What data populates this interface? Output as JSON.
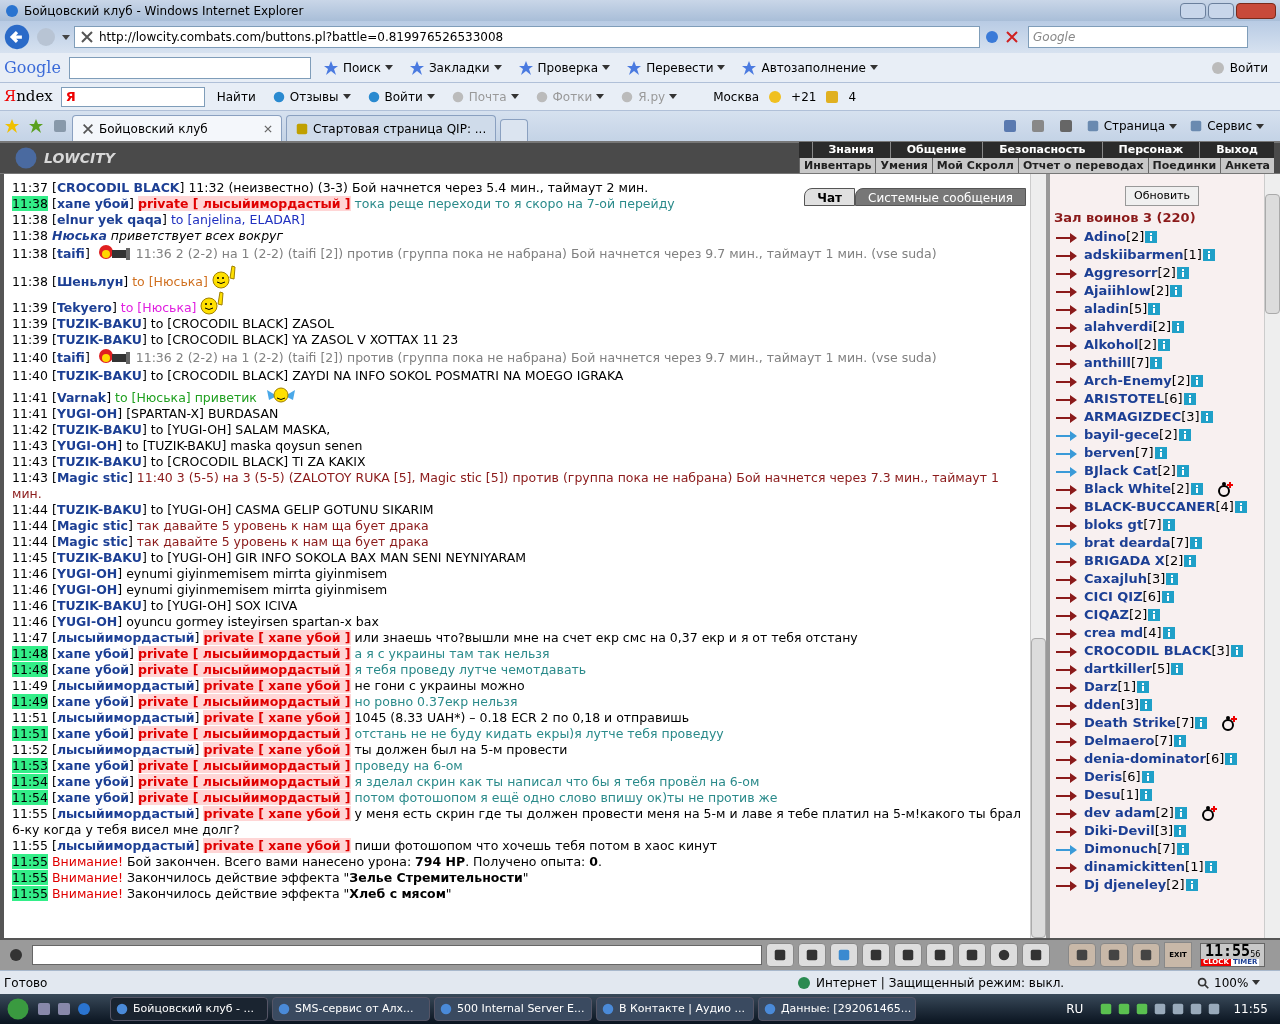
{
  "window": {
    "title": "Бойцовский клуб - Windows Internet Explorer"
  },
  "address_bar": {
    "url": "http://lowcity.combats.com/buttons.pl?battle=0.819976526533008",
    "search_placeholder": "Google"
  },
  "google_toolbar": {
    "logo": "Google",
    "items": [
      {
        "label": "Поиск"
      },
      {
        "label": "Закладки"
      },
      {
        "label": "Проверка"
      },
      {
        "label": "Перевести"
      },
      {
        "label": "Автозаполнение"
      }
    ],
    "sign_in": "Войти"
  },
  "yandex_toolbar": {
    "logo": "Яndex",
    "logo_short": "Я",
    "search_button": "Найти",
    "items": [
      {
        "label": "Отзывы",
        "disabled": false
      },
      {
        "label": "Войти",
        "disabled": false
      },
      {
        "label": "Почта",
        "disabled": true
      },
      {
        "label": "Фотки",
        "disabled": true
      },
      {
        "label": "Я.ру",
        "disabled": true
      }
    ],
    "city": "Москва",
    "temperature": "+21",
    "traffic": "4"
  },
  "browser_tabs": [
    {
      "label": "Бойцовский клуб",
      "selected": true
    },
    {
      "label": "Стартовая страница QIP: ...",
      "selected": false
    }
  ],
  "command_bar": [
    "Страница",
    "Сервис"
  ],
  "game_header": {
    "logo": "LOWCITY",
    "menu_top": [
      "Знания",
      "Общение",
      "Безопасность",
      "Персонаж",
      "Выход"
    ],
    "menu_bottom": [
      "Инвентарь",
      "Умения",
      "Мой Скролл",
      "Отчет о переводах",
      "Поединки",
      "Анкета"
    ]
  },
  "chat_tabs": [
    {
      "label": "Чат",
      "selected": true
    },
    {
      "label": "Системные сообщения",
      "selected": false
    }
  ],
  "messages": [
    {
      "time": "11:37",
      "highlighted": false,
      "kind": "chat",
      "sender": "[**CROCODIL BLACK**]",
      "parts": [
        {
          "kind": "text",
          "text": "11:32 (неизвестно) (3-3) Бой начнется через 5.4 мин., таймаут 2 мин.",
          "color": "#000000"
        }
      ]
    },
    {
      "time": "11:38",
      "highlighted": true,
      "kind": "chat",
      "sender": "[**хапе убой**]",
      "private": "private [ лысыйимордастый ]",
      "parts": [
        {
          "kind": "text",
          "text": "тока реще переходи то я скоро на 7-ой перейду",
          "color": "#2a8a8a"
        }
      ]
    },
    {
      "time": "11:38",
      "highlighted": false,
      "kind": "chat",
      "sender": "[**elnur yek qaqa**]",
      "parts": [
        {
          "kind": "text",
          "text": "to [anjelina, ELADAR]",
          "color": "#2030c0"
        }
      ]
    },
    {
      "time": "11:38",
      "highlighted": false,
      "kind": "action",
      "sender": "Нюська",
      "parts": [
        {
          "kind": "text",
          "text": "приветствует всех вокруг",
          "color": "#000000"
        }
      ]
    },
    {
      "time": "11:38",
      "highlighted": false,
      "kind": "chat",
      "sender": "[**taifi**]",
      "parts": [
        {
          "kind": "flag"
        },
        {
          "kind": "text",
          "text": "11:36 2 (2-2) на 1 (2-2) (taifi [2]) против (группа пока не набрана) Бой начнется через 9.7 мин., таймаут 1 мин. (vse suda)",
          "color": "#808080"
        }
      ]
    },
    {
      "time": "11:38",
      "highlighted": false,
      "kind": "chat",
      "sender": "[**Шеньлун**]",
      "parts": [
        {
          "kind": "text",
          "text": "to [Нюська]",
          "color": "#d07020"
        },
        {
          "kind": "wave"
        }
      ]
    },
    {
      "time": "11:39",
      "highlighted": false,
      "kind": "chat",
      "sender": "[**Tekyero**]",
      "parts": [
        {
          "kind": "text",
          "text": "to [Нюська]",
          "color": "#e020e0"
        },
        {
          "kind": "wave"
        }
      ]
    },
    {
      "time": "11:39",
      "highlighted": false,
      "kind": "chat",
      "sender": "[**TUZIK-BAKU**]",
      "parts": [
        {
          "kind": "text",
          "text": "to [CROCODIL BLACK] ZASOL",
          "color": "#000000"
        }
      ]
    },
    {
      "time": "11:39",
      "highlighted": false,
      "kind": "chat",
      "sender": "[**TUZIK-BAKU**]",
      "parts": [
        {
          "kind": "text",
          "text": "to [CROCODIL BLACK] YA ZASOL V XOTTAX 11 23",
          "color": "#000000"
        }
      ]
    },
    {
      "time": "11:40",
      "highlighted": false,
      "kind": "chat",
      "sender": "[**taifi**]",
      "parts": [
        {
          "kind": "flag"
        },
        {
          "kind": "text",
          "text": "11:36 2 (2-2) на 1 (2-2) (taifi [2]) против (группа пока не набрана) Бой начнется через 9.7 мин., таймаут 1 мин. (vse suda)",
          "color": "#808080"
        }
      ]
    },
    {
      "time": "11:40",
      "highlighted": false,
      "kind": "chat",
      "sender": "[**TUZIK-BAKU**]",
      "parts": [
        {
          "kind": "text",
          "text": "to [CROCODIL BLACK] ZAYDI NA INFO SOKOL POSMATRI NA MOEGO IGRAKA",
          "color": "#000000"
        }
      ]
    },
    {
      "time": "11:41",
      "highlighted": false,
      "kind": "chat",
      "sender": "[**Varnak**]",
      "parts": [
        {
          "kind": "text",
          "text": "to [Нюська] приветик",
          "color": "#20a020"
        },
        {
          "kind": "bird"
        }
      ]
    },
    {
      "time": "11:41",
      "highlighted": false,
      "kind": "chat",
      "sender": "[**YUGI-OH**]",
      "parts": [
        {
          "kind": "text",
          "text": "[SPARTAN-X] BURDASAN",
          "color": "#000000"
        }
      ]
    },
    {
      "time": "11:42",
      "highlighted": false,
      "kind": "chat",
      "sender": "[**TUZIK-BAKU**]",
      "parts": [
        {
          "kind": "text",
          "text": "to [YUGI-OH] SALAM MASKA,",
          "color": "#000000"
        }
      ]
    },
    {
      "time": "11:43",
      "highlighted": false,
      "kind": "chat",
      "sender": "[**YUGI-OH**]",
      "parts": [
        {
          "kind": "text",
          "text": "to [TUZIK-BAKU] maska qoysun senen",
          "color": "#000000"
        }
      ]
    },
    {
      "time": "11:43",
      "highlighted": false,
      "kind": "chat",
      "sender": "[**TUZIK-BAKU**]",
      "parts": [
        {
          "kind": "text",
          "text": "to [CROCODIL BLACK] TI ZA KAKIX",
          "color": "#000000"
        }
      ]
    },
    {
      "time": "11:43",
      "highlighted": false,
      "kind": "chat",
      "sender": "[**Magic stic**]",
      "parts": [
        {
          "kind": "text",
          "text": "11:40 3 (5-5) на 3 (5-5) (ZALOTOY RUKA [5], Magic stic [5]) против (группа пока не набрана) Бой начнется через 7.3 мин., таймаут 1 мин.",
          "color": "#8b1a1a"
        }
      ]
    },
    {
      "time": "11:44",
      "highlighted": false,
      "kind": "chat",
      "sender": "[**TUZIK-BAKU**]",
      "parts": [
        {
          "kind": "text",
          "text": "to [YUGI-OH] CASMA GELIP GOTUNU SIKARIM",
          "color": "#000000"
        }
      ]
    },
    {
      "time": "11:44",
      "highlighted": false,
      "kind": "chat",
      "sender": "[**Magic stic**]",
      "parts": [
        {
          "kind": "text",
          "text": "так давайте 5 уровень к нам ща бует драка",
          "color": "#8b1a1a"
        }
      ]
    },
    {
      "time": "11:44",
      "highlighted": false,
      "kind": "chat",
      "sender": "[**Magic stic**]",
      "parts": [
        {
          "kind": "text",
          "text": "так давайте 5 уровень к нам ща бует драка",
          "color": "#8b1a1a"
        }
      ]
    },
    {
      "time": "11:45",
      "highlighted": false,
      "kind": "chat",
      "sender": "[**TUZIK-BAKU**]",
      "parts": [
        {
          "kind": "text",
          "text": "to [YUGI-OH] GIR INFO SOKOLA BAX MAN SENI NEYNIYARAM",
          "color": "#000000"
        }
      ]
    },
    {
      "time": "11:46",
      "highlighted": false,
      "kind": "chat",
      "sender": "[**YUGI-OH**]",
      "parts": [
        {
          "kind": "text",
          "text": "eynumi giyinmemisem mirrta giyinmisem",
          "color": "#000000"
        }
      ]
    },
    {
      "time": "11:46",
      "highlighted": false,
      "kind": "chat",
      "sender": "[**YUGI-OH**]",
      "parts": [
        {
          "kind": "text",
          "text": "eynumi giyinmemisem mirrta giyinmisem",
          "color": "#000000"
        }
      ]
    },
    {
      "time": "11:46",
      "highlighted": false,
      "kind": "chat",
      "sender": "[**TUZIK-BAKU**]",
      "parts": [
        {
          "kind": "text",
          "text": "to [YUGI-OH] SOX ICIVA",
          "color": "#000000"
        }
      ]
    },
    {
      "time": "11:46",
      "highlighted": false,
      "kind": "chat",
      "sender": "[**YUGI-OH**]",
      "parts": [
        {
          "kind": "text",
          "text": "oyuncu gormey isteyirsen spartan-x bax",
          "color": "#000000"
        }
      ]
    },
    {
      "time": "11:47",
      "highlighted": false,
      "kind": "chat",
      "sender": "[**лысыйимордастый**]",
      "private": "private [ хапе убой ]",
      "parts": [
        {
          "kind": "text",
          "text": "или знаешь что?вышли мне на счет екр смс на 0,37 екр и я от тебя отстану",
          "color": "#000000"
        }
      ]
    },
    {
      "time": "11:48",
      "highlighted": true,
      "kind": "chat",
      "sender": "[**хапе убой**]",
      "private": "private [ лысыйимордастый ]",
      "parts": [
        {
          "kind": "text",
          "text": "а я с украины там так нельзя",
          "color": "#2a8a8a"
        }
      ]
    },
    {
      "time": "11:48",
      "highlighted": true,
      "kind": "chat",
      "sender": "[**хапе убой**]",
      "private": "private [ лысыйимордастый ]",
      "parts": [
        {
          "kind": "text",
          "text": "я тебя проведу лутче чемотдавать",
          "color": "#2a8a8a"
        }
      ]
    },
    {
      "time": "11:49",
      "highlighted": false,
      "kind": "chat",
      "sender": "[**лысыйимордастый**]",
      "private": "private [ хапе убой ]",
      "parts": [
        {
          "kind": "text",
          "text": "не гони с украины можно",
          "color": "#000000"
        }
      ]
    },
    {
      "time": "11:49",
      "highlighted": true,
      "kind": "chat",
      "sender": "[**хапе убой**]",
      "private": "private [ лысыйимордастый ]",
      "parts": [
        {
          "kind": "text",
          "text": "но ровно 0.37екр нельзя",
          "color": "#2a8a8a"
        }
      ]
    },
    {
      "time": "11:51",
      "highlighted": false,
      "kind": "chat",
      "sender": "[**лысыйимордастый**]",
      "private": "private [ хапе убой ]",
      "parts": [
        {
          "kind": "text",
          "text": "1045 (8.33 UAH*) – 0.18 ECR 2 по 0,18 и отправишь",
          "color": "#000000"
        }
      ]
    },
    {
      "time": "11:51",
      "highlighted": true,
      "kind": "chat",
      "sender": "[**хапе убой**]",
      "private": "private [ лысыйимордастый ]",
      "parts": [
        {
          "kind": "text",
          "text": "отстань не не буду кидать екры)я лутче тебя проведуу",
          "color": "#2a8a8a"
        }
      ]
    },
    {
      "time": "11:52",
      "highlighted": false,
      "kind": "chat",
      "sender": "[**лысыйимордастый**]",
      "private": "private [ хапе убой ]",
      "parts": [
        {
          "kind": "text",
          "text": "ты должен был на 5-м провести",
          "color": "#000000"
        }
      ]
    },
    {
      "time": "11:53",
      "highlighted": true,
      "kind": "chat",
      "sender": "[**хапе убой**]",
      "private": "private [ лысыйимордастый ]",
      "parts": [
        {
          "kind": "text",
          "text": "проведу на 6-ом",
          "color": "#2a8a8a"
        }
      ]
    },
    {
      "time": "11:54",
      "highlighted": true,
      "kind": "chat",
      "sender": "[**хапе убой**]",
      "private": "private [ лысыйимордастый ]",
      "parts": [
        {
          "kind": "text",
          "text": "я зделал скрин как ты написал что бы я тебя провёл на 6-ом",
          "color": "#2a8a8a"
        }
      ]
    },
    {
      "time": "11:54",
      "highlighted": true,
      "kind": "chat",
      "sender": "[**хапе убой**]",
      "private": "private [ лысыйимордастый ]",
      "parts": [
        {
          "kind": "text",
          "text": "потом фотошопом я ещё одно слово впишу ок)ты не против же",
          "color": "#2a8a8a"
        }
      ]
    },
    {
      "time": "11:55",
      "highlighted": false,
      "kind": "chat",
      "sender": "[**лысыйимордастый**]",
      "private": "private [ хапе убой ]",
      "parts": [
        {
          "kind": "text",
          "text": "у меня есть скрин где ты должен провести меня на 5-м и лаве я тебе платил на 5-м!какого ты брал 6-ку когда у тебя висел мне долг?",
          "color": "#000000"
        }
      ]
    },
    {
      "time": "11:55",
      "highlighted": false,
      "kind": "chat",
      "sender": "[**лысыйимордастый**]",
      "private": "private [ хапе убой ]",
      "parts": [
        {
          "kind": "text",
          "text": "пиши фотошопом что хочешь тебя потом в хаос кинут",
          "color": "#000000"
        }
      ]
    },
    {
      "time": "11:55",
      "highlighted": true,
      "kind": "system",
      "sender": "Внимание!",
      "parts": [
        {
          "kind": "text",
          "text": "Бой закончен. Всего вами нанесено урона: **794 HP**. Получено опыта: **0**.",
          "color": "#000000"
        }
      ]
    },
    {
      "time": "11:55",
      "highlighted": true,
      "kind": "system",
      "sender": "Внимание!",
      "parts": [
        {
          "kind": "text",
          "text": "Закончилось действие эффекта \"**Зелье Стремительности**\"",
          "color": "#000000"
        }
      ]
    },
    {
      "time": "11:55",
      "highlighted": true,
      "kind": "system",
      "sender": "Внимание!",
      "parts": [
        {
          "kind": "text",
          "text": "Закончилось действие эффекта \"**Хлеб с мясом**\"",
          "color": "#000000"
        }
      ]
    }
  ],
  "room": {
    "refresh_button": "Обновить",
    "title": "Зал воинов 3 (220)",
    "players": [
      {
        "name": "Adino",
        "level": "[2]",
        "color": "#8b1a1a",
        "badge": false
      },
      {
        "name": "adskiibarmen",
        "level": "[1]",
        "color": "#8b1a1a",
        "badge": false
      },
      {
        "name": "Aggresorr",
        "level": "[2]",
        "color": "#8b1a1a",
        "badge": false
      },
      {
        "name": "Ajaiihlow",
        "level": "[2]",
        "color": "#8b1a1a",
        "badge": false
      },
      {
        "name": "aladin",
        "level": "[5]",
        "color": "#8b1a1a",
        "badge": false
      },
      {
        "name": "alahverdi",
        "level": "[2]",
        "color": "#8b1a1a",
        "badge": false
      },
      {
        "name": "Alkohol",
        "level": "[2]",
        "color": "#8b1a1a",
        "badge": false
      },
      {
        "name": "anthill",
        "level": "[7]",
        "color": "#8b1a1a",
        "badge": false
      },
      {
        "name": "Arch-Enemy",
        "level": "[2]",
        "color": "#8b1a1a",
        "badge": false
      },
      {
        "name": "ARISTOTEL",
        "level": "[6]",
        "color": "#8b1a1a",
        "badge": false
      },
      {
        "name": "ARMAGIZDEC",
        "level": "[3]",
        "color": "#8b1a1a",
        "badge": false
      },
      {
        "name": "bayil-gece",
        "level": "[2]",
        "color": "#3a9ad8",
        "badge": false
      },
      {
        "name": "berven",
        "level": "[7]",
        "color": "#3a9ad8",
        "badge": false
      },
      {
        "name": "BJlack Cat",
        "level": "[2]",
        "color": "#3a9ad8",
        "badge": false
      },
      {
        "name": "Black White",
        "level": "[2]",
        "color": "#8b1a1a",
        "badge": true
      },
      {
        "name": "BLACK-BUCCANER",
        "level": "[4]",
        "color": "#8b1a1a",
        "badge": false
      },
      {
        "name": "bloks gt",
        "level": "[7]",
        "color": "#8b1a1a",
        "badge": false
      },
      {
        "name": "brat dearda",
        "level": "[7]",
        "color": "#3a9ad8",
        "badge": false
      },
      {
        "name": "BRIGADA X",
        "level": "[2]",
        "color": "#8b1a1a",
        "badge": false
      },
      {
        "name": "Caxajluh",
        "level": "[3]",
        "color": "#8b1a1a",
        "badge": false
      },
      {
        "name": "CICI QIZ",
        "level": "[6]",
        "color": "#8b1a1a",
        "badge": false
      },
      {
        "name": "CIQAZ",
        "level": "[2]",
        "color": "#8b1a1a",
        "badge": false
      },
      {
        "name": "crea md",
        "level": "[4]",
        "color": "#8b1a1a",
        "badge": false
      },
      {
        "name": "CROCODIL BLACK",
        "level": "[3]",
        "color": "#8b1a1a",
        "badge": false
      },
      {
        "name": "dartkiller",
        "level": "[5]",
        "color": "#8b1a1a",
        "badge": false
      },
      {
        "name": "Darz",
        "level": "[1]",
        "color": "#8b1a1a",
        "badge": false
      },
      {
        "name": "dden",
        "level": "[3]",
        "color": "#8b1a1a",
        "badge": false
      },
      {
        "name": "Death Strike",
        "level": "[7]",
        "color": "#8b1a1a",
        "badge": true
      },
      {
        "name": "Delmaero",
        "level": "[7]",
        "color": "#8b1a1a",
        "badge": false
      },
      {
        "name": "denia-dominator",
        "level": "[6]",
        "color": "#8b1a1a",
        "badge": false
      },
      {
        "name": "Deris",
        "level": "[6]",
        "color": "#8b1a1a",
        "badge": false
      },
      {
        "name": "Desu",
        "level": "[1]",
        "color": "#8b1a1a",
        "badge": false
      },
      {
        "name": "dev adam",
        "level": "[2]",
        "color": "#8b1a1a",
        "badge": true
      },
      {
        "name": "Diki-Devil",
        "level": "[3]",
        "color": "#8b1a1a",
        "badge": false
      },
      {
        "name": "Dimonuch",
        "level": "[7]",
        "color": "#3a9ad8",
        "badge": false
      },
      {
        "name": "dinamickitten",
        "level": "[1]",
        "color": "#8b1a1a",
        "badge": false
      },
      {
        "name": "Dj djeneley",
        "level": "[2]",
        "color": "#8b1a1a",
        "badge": false
      }
    ]
  },
  "chat_input": {
    "clock": "11:55",
    "seconds": "56",
    "clock_label": "CLOCK",
    "timer_label": "TIMER",
    "exit_label": "EXIT"
  },
  "status_bar": {
    "status": "Готово",
    "zone": "Интернет | Защищенный режим: выкл.",
    "zoom": "100%"
  },
  "taskbar": {
    "tasks": [
      {
        "label": "Бойцовский клуб - ...",
        "selected": true
      },
      {
        "label": "SMS-сервис от Алх...",
        "selected": false
      },
      {
        "label": "500 Internal Server E...",
        "selected": false
      },
      {
        "label": "В Контакте | Аудио ...",
        "selected": false
      },
      {
        "label": "Данные: [292061465...",
        "selected": false
      }
    ],
    "language": "RU",
    "time": "11:55"
  }
}
